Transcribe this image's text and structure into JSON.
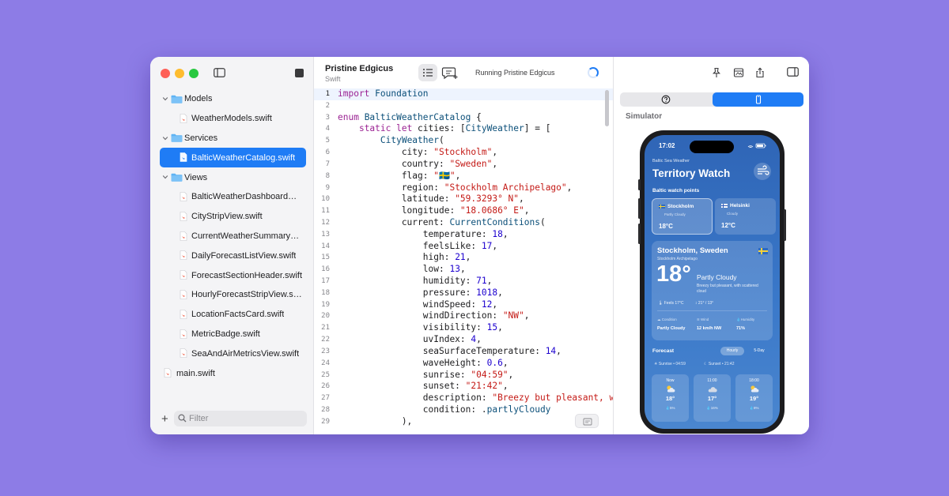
{
  "colors": {
    "background": "#8d7ce6",
    "accent": "#1f7cf5",
    "keyword": "#9b2393",
    "string": "#c41a16",
    "number": "#1c00cf",
    "type": "#0b4f79"
  },
  "sidebar": {
    "items": [
      {
        "label": "Models",
        "kind": "folder",
        "expanded": true,
        "level": 0
      },
      {
        "label": "WeatherModels.swift",
        "kind": "swift",
        "level": 1
      },
      {
        "label": "Services",
        "kind": "folder",
        "expanded": true,
        "level": 0
      },
      {
        "label": "BalticWeatherCatalog.swift",
        "kind": "swift",
        "level": 1,
        "selected": true
      },
      {
        "label": "Views",
        "kind": "folder",
        "expanded": true,
        "level": 0
      },
      {
        "label": "BalticWeatherDashboardVie...",
        "kind": "swift",
        "level": 1
      },
      {
        "label": "CityStripView.swift",
        "kind": "swift",
        "level": 1
      },
      {
        "label": "CurrentWeatherSummaryVi...",
        "kind": "swift",
        "level": 1
      },
      {
        "label": "DailyForecastListView.swift",
        "kind": "swift",
        "level": 1
      },
      {
        "label": "ForecastSectionHeader.swift",
        "kind": "swift",
        "level": 1
      },
      {
        "label": "HourlyForecastStripView.sw...",
        "kind": "swift",
        "level": 1
      },
      {
        "label": "LocationFactsCard.swift",
        "kind": "swift",
        "level": 1
      },
      {
        "label": "MetricBadge.swift",
        "kind": "swift",
        "level": 1
      },
      {
        "label": "SeaAndAirMetricsView.swift",
        "kind": "swift",
        "level": 1
      },
      {
        "label": "main.swift",
        "kind": "swift",
        "level": 0
      }
    ],
    "filter_placeholder": "Filter",
    "add_label": "+"
  },
  "editor": {
    "project_title": "Pristine Edgicus",
    "language": "Swift",
    "status": "Running Pristine Edgicus",
    "active_line": 1,
    "lines": [
      [
        [
          "import ",
          "kw"
        ],
        [
          "Foundation",
          "ty"
        ]
      ],
      [],
      [
        [
          "enum ",
          "kw"
        ],
        [
          "BalticWeatherCatalog",
          "ty"
        ],
        [
          " {",
          ""
        ]
      ],
      [
        [
          "    ",
          ""
        ],
        [
          "static let ",
          "kw"
        ],
        [
          "cities: [",
          ""
        ],
        [
          "CityWeather",
          "ty"
        ],
        [
          "] = [",
          ""
        ]
      ],
      [
        [
          "        ",
          ""
        ],
        [
          "CityWeather",
          "ty"
        ],
        [
          "(",
          ""
        ]
      ],
      [
        [
          "            city: ",
          ""
        ],
        [
          "\"Stockholm\"",
          "st"
        ],
        [
          ",",
          ""
        ]
      ],
      [
        [
          "            country: ",
          ""
        ],
        [
          "\"Sweden\"",
          "st"
        ],
        [
          ",",
          ""
        ]
      ],
      [
        [
          "            flag: ",
          ""
        ],
        [
          "\"🇸🇪\"",
          "st"
        ],
        [
          ",",
          ""
        ]
      ],
      [
        [
          "            region: ",
          ""
        ],
        [
          "\"Stockholm Archipelago\"",
          "st"
        ],
        [
          ",",
          ""
        ]
      ],
      [
        [
          "            latitude: ",
          ""
        ],
        [
          "\"59.3293° N\"",
          "st"
        ],
        [
          ",",
          ""
        ]
      ],
      [
        [
          "            longitude: ",
          ""
        ],
        [
          "\"18.0686° E\"",
          "st"
        ],
        [
          ",",
          ""
        ]
      ],
      [
        [
          "            current: ",
          ""
        ],
        [
          "CurrentConditions",
          "ty"
        ],
        [
          "(",
          ""
        ]
      ],
      [
        [
          "                temperature: ",
          ""
        ],
        [
          "18",
          "nu"
        ],
        [
          ",",
          ""
        ]
      ],
      [
        [
          "                feelsLike: ",
          ""
        ],
        [
          "17",
          "nu"
        ],
        [
          ",",
          ""
        ]
      ],
      [
        [
          "                high: ",
          ""
        ],
        [
          "21",
          "nu"
        ],
        [
          ",",
          ""
        ]
      ],
      [
        [
          "                low: ",
          ""
        ],
        [
          "13",
          "nu"
        ],
        [
          ",",
          ""
        ]
      ],
      [
        [
          "                humidity: ",
          ""
        ],
        [
          "71",
          "nu"
        ],
        [
          ",",
          ""
        ]
      ],
      [
        [
          "                pressure: ",
          ""
        ],
        [
          "1018",
          "nu"
        ],
        [
          ",",
          ""
        ]
      ],
      [
        [
          "                windSpeed: ",
          ""
        ],
        [
          "12",
          "nu"
        ],
        [
          ",",
          ""
        ]
      ],
      [
        [
          "                windDirection: ",
          ""
        ],
        [
          "\"NW\"",
          "st"
        ],
        [
          ",",
          ""
        ]
      ],
      [
        [
          "                visibility: ",
          ""
        ],
        [
          "15",
          "nu"
        ],
        [
          ",",
          ""
        ]
      ],
      [
        [
          "                uvIndex: ",
          ""
        ],
        [
          "4",
          "nu"
        ],
        [
          ",",
          ""
        ]
      ],
      [
        [
          "                seaSurfaceTemperature: ",
          ""
        ],
        [
          "14",
          "nu"
        ],
        [
          ",",
          ""
        ]
      ],
      [
        [
          "                waveHeight: ",
          ""
        ],
        [
          "0.6",
          "nu"
        ],
        [
          ",",
          ""
        ]
      ],
      [
        [
          "                sunrise: ",
          ""
        ],
        [
          "\"04:59\"",
          "st"
        ],
        [
          ",",
          ""
        ]
      ],
      [
        [
          "                sunset: ",
          ""
        ],
        [
          "\"21:42\"",
          "st"
        ],
        [
          ",",
          ""
        ]
      ],
      [
        [
          "                description: ",
          ""
        ],
        [
          "\"Breezy but pleasant, w",
          "st"
        ]
      ],
      [
        [
          "                condition: .",
          ""
        ],
        [
          "partlyCloudy",
          "ty"
        ]
      ],
      [
        [
          "            ),",
          ""
        ]
      ]
    ]
  },
  "simulator": {
    "label": "Simulator",
    "phone": {
      "time": "17:02",
      "app_name": "Baltic Sea Weather",
      "title": "Territory Watch",
      "section": "Baltic watch points",
      "cities": [
        {
          "name": "Stockholm",
          "condition": "Partly Cloudy",
          "temp": "18°C",
          "flag": "se",
          "selected": true
        },
        {
          "name": "Helsinki",
          "condition": "Cloudy",
          "temp": "12°C",
          "flag": "fi",
          "selected": false
        }
      ],
      "current": {
        "city": "Stockholm, Sweden",
        "region": "Stockholm Archipelago",
        "temp": "18°",
        "condition": "Partly Cloudy",
        "description": "Breezy but pleasant, with scattered cloud",
        "feels": "Feels 17°C",
        "hilo": "21° / 13°",
        "metrics": [
          {
            "label": "Condition",
            "value": "Partly Cloudy"
          },
          {
            "label": "Wind",
            "value": "12 km/h NW"
          },
          {
            "label": "Humidity",
            "value": "71%"
          }
        ]
      },
      "forecast": {
        "title": "Forecast",
        "toggle_on": "Hourly",
        "toggle_off": "5-Day",
        "sunrise": "Sunrise • 04:59",
        "sunset": "Sunset • 21:42",
        "hours": [
          {
            "time": "Now",
            "temp": "18°",
            "pct": "5%",
            "icon": "sun-cloud-icon"
          },
          {
            "time": "11:00",
            "temp": "17°",
            "pct": "16%",
            "icon": "cloud-icon"
          },
          {
            "time": "18:00",
            "temp": "19°",
            "pct": "8%",
            "icon": "sun-cloud-icon"
          }
        ]
      }
    }
  }
}
